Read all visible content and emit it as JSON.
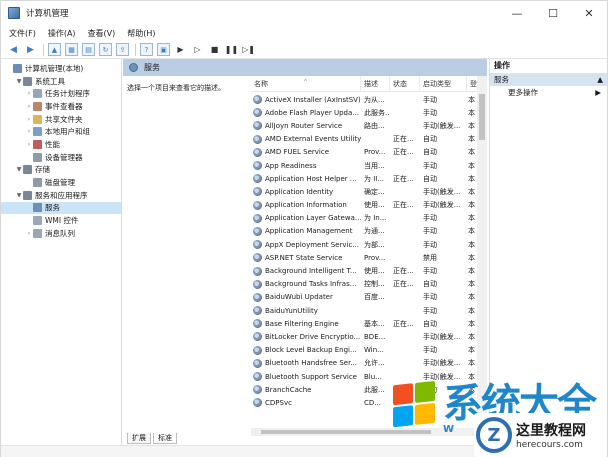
{
  "window": {
    "title": "计算机管理",
    "minimize": "—",
    "maximize": "☐",
    "close": "✕"
  },
  "menu": [
    "文件(F)",
    "操作(A)",
    "查看(V)",
    "帮助(H)"
  ],
  "tree": [
    {
      "label": "计算机管理(本地)",
      "level": 0,
      "arrow": "",
      "color": "#6b8db8"
    },
    {
      "label": "系统工具",
      "level": 1,
      "arrow": "▼",
      "color": "#7a8797"
    },
    {
      "label": "任务计划程序",
      "level": 2,
      "arrow": "›",
      "color": "#9aa7b6"
    },
    {
      "label": "事件查看器",
      "level": 2,
      "arrow": "›",
      "color": "#b8866a"
    },
    {
      "label": "共享文件夹",
      "level": 2,
      "arrow": "›",
      "color": "#d9b65a"
    },
    {
      "label": "本地用户和组",
      "level": 2,
      "arrow": "›",
      "color": "#7b9fc5"
    },
    {
      "label": "性能",
      "level": 2,
      "arrow": "›",
      "color": "#c25b5b"
    },
    {
      "label": "设备管理器",
      "level": 2,
      "arrow": "",
      "color": "#8e9aa8"
    },
    {
      "label": "存储",
      "level": 1,
      "arrow": "▼",
      "color": "#7a8797"
    },
    {
      "label": "磁盘管理",
      "level": 2,
      "arrow": "",
      "color": "#8e9aa8"
    },
    {
      "label": "服务和应用程序",
      "level": 1,
      "arrow": "▼",
      "color": "#7a8797"
    },
    {
      "label": "服务",
      "level": 2,
      "arrow": "",
      "color": "#6f8fb5",
      "selected": true
    },
    {
      "label": "WMI 控件",
      "level": 2,
      "arrow": "",
      "color": "#9aa7b6"
    },
    {
      "label": "消息队列",
      "level": 2,
      "arrow": "›",
      "color": "#9aa7b6"
    }
  ],
  "middle": {
    "header": "服务",
    "description": "选择一个项目来查看它的描述。",
    "columns": {
      "name": "名称",
      "desc": "描述",
      "status": "状态",
      "startup": "启动类型",
      "more": "登"
    },
    "sort_arrow": "^",
    "services": [
      {
        "name": "ActiveX Installer (AxInstSV)",
        "desc": "为从...",
        "status": "",
        "startup": "手动",
        "more": "本"
      },
      {
        "name": "Adobe Flash Player Upda...",
        "desc": "此服务...",
        "status": "",
        "startup": "手动",
        "more": "本"
      },
      {
        "name": "AllJoyn Router Service",
        "desc": "路由...",
        "status": "",
        "startup": "手动(触发...",
        "more": "本"
      },
      {
        "name": "AMD External Events Utility",
        "desc": "",
        "status": "正在...",
        "startup": "自动",
        "more": "本"
      },
      {
        "name": "AMD FUEL Service",
        "desc": "Prov...",
        "status": "正在...",
        "startup": "自动",
        "more": "本"
      },
      {
        "name": "App Readiness",
        "desc": "当用...",
        "status": "",
        "startup": "手动",
        "more": "本"
      },
      {
        "name": "Application Host Helper ...",
        "desc": "为 II...",
        "status": "正在...",
        "startup": "自动",
        "more": "本"
      },
      {
        "name": "Application Identity",
        "desc": "确定...",
        "status": "",
        "startup": "手动(触发...",
        "more": "本"
      },
      {
        "name": "Application Information",
        "desc": "使用...",
        "status": "正在...",
        "startup": "手动(触发...",
        "more": "本"
      },
      {
        "name": "Application Layer Gatewa...",
        "desc": "为 In...",
        "status": "",
        "startup": "手动",
        "more": "本"
      },
      {
        "name": "Application Management",
        "desc": "为通...",
        "status": "",
        "startup": "手动",
        "more": "本"
      },
      {
        "name": "AppX Deployment Servic...",
        "desc": "为部...",
        "status": "",
        "startup": "手动",
        "more": "本"
      },
      {
        "name": "ASP.NET State Service",
        "desc": "Prov...",
        "status": "",
        "startup": "禁用",
        "more": "本"
      },
      {
        "name": "Background Intelligent T...",
        "desc": "使用...",
        "status": "正在...",
        "startup": "手动",
        "more": "本"
      },
      {
        "name": "Background Tasks Infras...",
        "desc": "控制...",
        "status": "正在...",
        "startup": "自动",
        "more": "本"
      },
      {
        "name": "BaiduWubi Updater",
        "desc": "百度...",
        "status": "",
        "startup": "手动",
        "more": "本"
      },
      {
        "name": "BaiduYunUtility",
        "desc": "",
        "status": "",
        "startup": "手动",
        "more": "本"
      },
      {
        "name": "Base Filtering Engine",
        "desc": "基本...",
        "status": "正在...",
        "startup": "自动",
        "more": "本"
      },
      {
        "name": "BitLocker Drive Encryptio...",
        "desc": "BDE...",
        "status": "",
        "startup": "手动(触发...",
        "more": "本"
      },
      {
        "name": "Block Level Backup Engi...",
        "desc": "Win...",
        "status": "",
        "startup": "手动",
        "more": "本"
      },
      {
        "name": "Bluetooth Handsfree Ser...",
        "desc": "允许...",
        "status": "",
        "startup": "手动(触发...",
        "more": "本"
      },
      {
        "name": "Bluetooth Support Service",
        "desc": "Blu...",
        "status": "",
        "startup": "手动(触发...",
        "more": "本"
      },
      {
        "name": "BranchCache",
        "desc": "此服...",
        "status": "",
        "startup": "手动",
        "more": "本"
      },
      {
        "name": "CDPSvc",
        "desc": "CD...",
        "status": "",
        "startup": "",
        "more": ""
      }
    ],
    "tabs": [
      "扩展",
      "标准"
    ]
  },
  "actions": {
    "title": "操作",
    "section": "服务",
    "section_arrow": "▲",
    "items": [
      {
        "label": "更多操作",
        "arrow": "▶"
      }
    ]
  },
  "watermark": {
    "brand": "系统大全",
    "brand_sub": "W",
    "site_cn": "这里教程网",
    "site_en": "herecours.com",
    "logo_letter": "Z"
  }
}
